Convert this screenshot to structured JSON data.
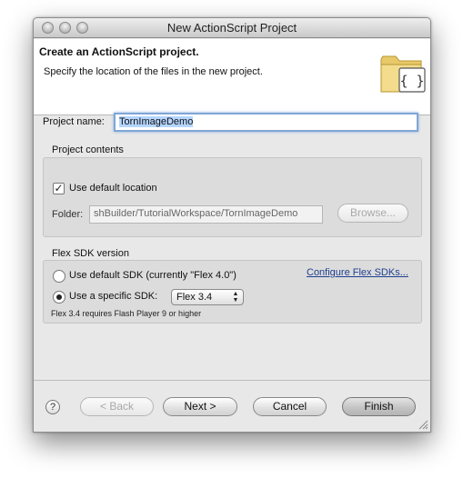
{
  "window": {
    "title": "New ActionScript Project"
  },
  "header": {
    "title": "Create an ActionScript project.",
    "description": "Specify the location of the files in the new project.",
    "icon": "actionscript-folder-icon",
    "icon_glyph": "{ }"
  },
  "project_name": {
    "label": "Project name:",
    "value": "TornImageDemo"
  },
  "project_contents": {
    "label": "Project contents",
    "use_default_label": "Use default location",
    "use_default_checked": true,
    "checkmark": "✓",
    "folder_label": "Folder:",
    "folder_value": "shBuilder/TutorialWorkspace/TornImageDemo",
    "browse_label": "Browse..."
  },
  "flex_sdk": {
    "label": "Flex SDK version",
    "default_option": "Use default SDK (currently \"Flex 4.0\")",
    "specific_option": "Use a specific SDK:",
    "selected_option": "specific",
    "sdk_value": "Flex 3.4",
    "configure_link": "Configure Flex SDKs...",
    "note": "Flex 3.4 requires Flash Player 9 or higher"
  },
  "footer": {
    "help": "?",
    "back": "< Back",
    "next": "Next >",
    "cancel": "Cancel",
    "finish": "Finish"
  }
}
